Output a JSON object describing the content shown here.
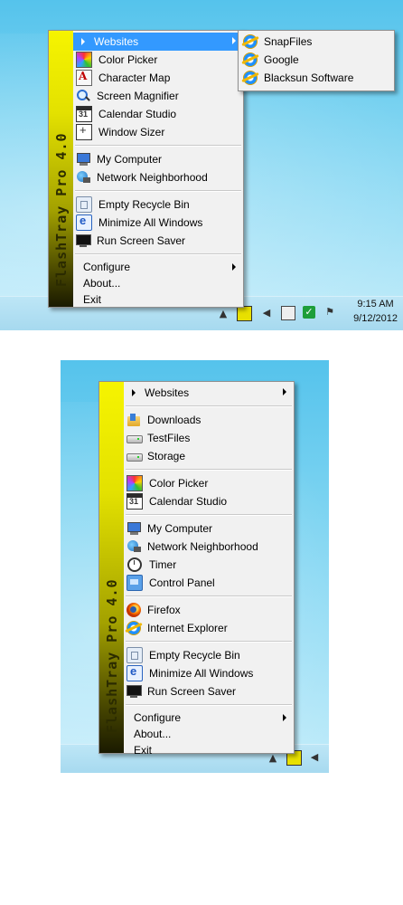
{
  "screen1": {
    "sidebar_title": "FlashTray Pro 4.0",
    "menu": [
      {
        "label": "Websites",
        "type": "submenu",
        "selected": true
      },
      {
        "label": "Color Picker",
        "icon": "color-picker-icon"
      },
      {
        "label": "Character Map",
        "icon": "character-map-icon"
      },
      {
        "label": "Screen Magnifier",
        "icon": "magnifier-icon"
      },
      {
        "label": "Calendar Studio",
        "icon": "calendar-icon"
      },
      {
        "label": "Window Sizer",
        "icon": "window-sizer-icon"
      },
      {
        "label": "My Computer",
        "icon": "computer-icon"
      },
      {
        "label": "Network Neighborhood",
        "icon": "network-icon"
      },
      {
        "label": "Empty Recycle Bin",
        "icon": "recycle-bin-icon"
      },
      {
        "label": "Minimize All Windows",
        "icon": "minimize-windows-icon"
      },
      {
        "label": "Run Screen Saver",
        "icon": "screen-saver-icon"
      },
      {
        "label": "Configure",
        "type": "submenu"
      },
      {
        "label": "About..."
      },
      {
        "label": "Exit"
      }
    ],
    "submenu": [
      {
        "label": "SnapFiles",
        "icon": "ie-icon"
      },
      {
        "label": "Google",
        "icon": "ie-icon"
      },
      {
        "label": "Blacksun Software",
        "icon": "ie-icon"
      }
    ],
    "clock": {
      "time": "9:15 AM",
      "date": "9/12/2012"
    }
  },
  "screen2": {
    "sidebar_title": "FlashTray Pro 4.0",
    "menu": [
      {
        "label": "Websites",
        "type": "submenu"
      },
      {
        "label": "Downloads",
        "icon": "downloads-folder-icon"
      },
      {
        "label": "TestFiles",
        "icon": "drive-icon"
      },
      {
        "label": "Storage",
        "icon": "drive-icon"
      },
      {
        "label": "Color Picker",
        "icon": "color-picker-icon"
      },
      {
        "label": "Calendar Studio",
        "icon": "calendar-icon"
      },
      {
        "label": "My Computer",
        "icon": "computer-icon"
      },
      {
        "label": "Network Neighborhood",
        "icon": "network-icon"
      },
      {
        "label": "Timer",
        "icon": "timer-icon"
      },
      {
        "label": "Control Panel",
        "icon": "control-panel-icon"
      },
      {
        "label": "Firefox",
        "icon": "firefox-icon"
      },
      {
        "label": "Internet Explorer",
        "icon": "ie-icon"
      },
      {
        "label": "Empty Recycle Bin",
        "icon": "recycle-bin-icon"
      },
      {
        "label": "Minimize All Windows",
        "icon": "minimize-windows-icon"
      },
      {
        "label": "Run Screen Saver",
        "icon": "screen-saver-icon"
      },
      {
        "label": "Configure",
        "type": "submenu"
      },
      {
        "label": "About..."
      },
      {
        "label": "Exit"
      }
    ]
  },
  "colors": {
    "selection": "#3399ff",
    "sidebar_top": "#f6f400",
    "sidebar_bottom": "#1a1a00",
    "menu_bg": "#f1f1f1"
  }
}
